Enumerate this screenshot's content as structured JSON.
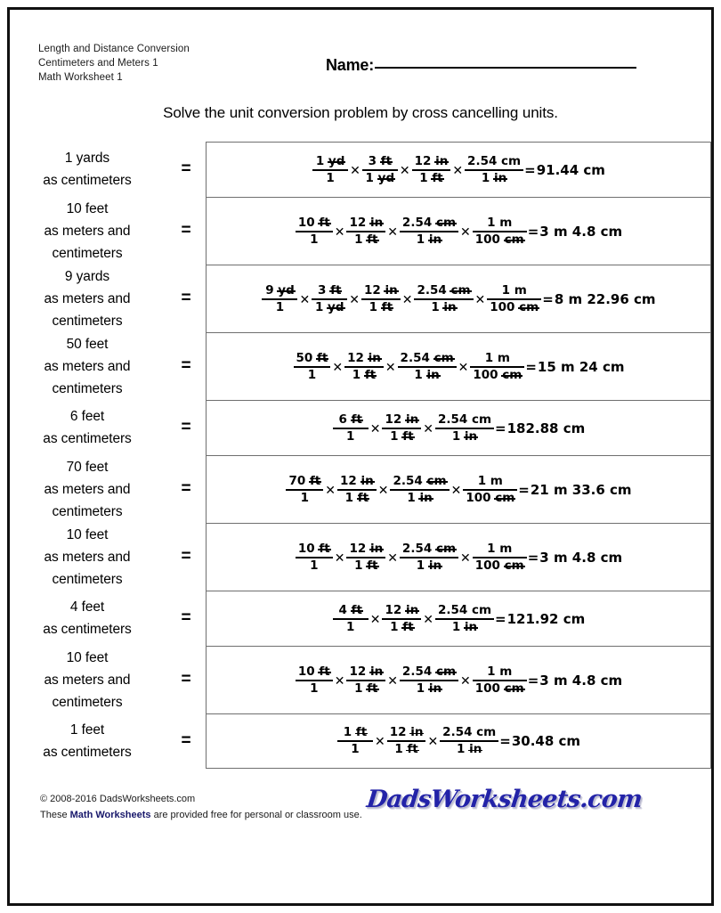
{
  "page": {
    "border_color": "#111111",
    "background": "#ffffff"
  },
  "header": {
    "meta_line1": "Length and Distance Conversion",
    "meta_line2": "Centimeters and Meters 1",
    "meta_line3": "Math Worksheet 1",
    "name_label": "Name:",
    "name_value": ""
  },
  "instructions": "Solve the unit conversion problem by cross cancelling units.",
  "equals": "=",
  "times": "✕",
  "problems": [
    {
      "prompt": [
        "1 yards",
        "as centimeters"
      ],
      "height": "short",
      "factors": [
        {
          "num": "1 yd",
          "num_cancel": "yd",
          "den": "1",
          "den_cancel": ""
        },
        {
          "num": "3 ft",
          "num_cancel": "ft",
          "den": "1 yd",
          "den_cancel": "yd"
        },
        {
          "num": "12 in",
          "num_cancel": "in",
          "den": "1 ft",
          "den_cancel": "ft"
        },
        {
          "num": "2.54 cm",
          "num_cancel": "",
          "den": "1 in",
          "den_cancel": "in"
        }
      ],
      "result": "91.44 cm"
    },
    {
      "prompt": [
        "10 feet",
        "as meters and",
        "centimeters"
      ],
      "height": "tall",
      "factors": [
        {
          "num": "10 ft",
          "num_cancel": "ft",
          "den": "1",
          "den_cancel": ""
        },
        {
          "num": "12 in",
          "num_cancel": "in",
          "den": "1 ft",
          "den_cancel": "ft"
        },
        {
          "num": "2.54 cm",
          "num_cancel": "cm",
          "den": "1 in",
          "den_cancel": "in"
        },
        {
          "num": "1 m",
          "num_cancel": "",
          "den": "100 cm",
          "den_cancel": "cm"
        }
      ],
      "result": "3 m 4.8 cm"
    },
    {
      "prompt": [
        "9 yards",
        "as meters and",
        "centimeters"
      ],
      "height": "tall",
      "factors": [
        {
          "num": "9 yd",
          "num_cancel": "yd",
          "den": "1",
          "den_cancel": ""
        },
        {
          "num": "3 ft",
          "num_cancel": "ft",
          "den": "1 yd",
          "den_cancel": "yd"
        },
        {
          "num": "12 in",
          "num_cancel": "in",
          "den": "1 ft",
          "den_cancel": "ft"
        },
        {
          "num": "2.54 cm",
          "num_cancel": "cm",
          "den": "1 in",
          "den_cancel": "in"
        },
        {
          "num": "1 m",
          "num_cancel": "",
          "den": "100 cm",
          "den_cancel": "cm"
        }
      ],
      "result": "8 m 22.96 cm"
    },
    {
      "prompt": [
        "50 feet",
        "as meters and",
        "centimeters"
      ],
      "height": "tall",
      "factors": [
        {
          "num": "50 ft",
          "num_cancel": "ft",
          "den": "1",
          "den_cancel": ""
        },
        {
          "num": "12 in",
          "num_cancel": "in",
          "den": "1 ft",
          "den_cancel": "ft"
        },
        {
          "num": "2.54 cm",
          "num_cancel": "cm",
          "den": "1 in",
          "den_cancel": "in"
        },
        {
          "num": "1 m",
          "num_cancel": "",
          "den": "100 cm",
          "den_cancel": "cm"
        }
      ],
      "result": "15 m 24 cm"
    },
    {
      "prompt": [
        "6 feet",
        "as centimeters"
      ],
      "height": "short",
      "factors": [
        {
          "num": "6 ft",
          "num_cancel": "ft",
          "den": "1",
          "den_cancel": ""
        },
        {
          "num": "12 in",
          "num_cancel": "in",
          "den": "1 ft",
          "den_cancel": "ft"
        },
        {
          "num": "2.54 cm",
          "num_cancel": "",
          "den": "1 in",
          "den_cancel": "in"
        }
      ],
      "result": "182.88 cm"
    },
    {
      "prompt": [
        "70 feet",
        "as meters and",
        "centimeters"
      ],
      "height": "tall",
      "factors": [
        {
          "num": "70 ft",
          "num_cancel": "ft",
          "den": "1",
          "den_cancel": ""
        },
        {
          "num": "12 in",
          "num_cancel": "in",
          "den": "1 ft",
          "den_cancel": "ft"
        },
        {
          "num": "2.54 cm",
          "num_cancel": "cm",
          "den": "1 in",
          "den_cancel": "in"
        },
        {
          "num": "1 m",
          "num_cancel": "",
          "den": "100 cm",
          "den_cancel": "cm"
        }
      ],
      "result": "21 m 33.6 cm"
    },
    {
      "prompt": [
        "10 feet",
        "as meters and",
        "centimeters"
      ],
      "height": "tall",
      "factors": [
        {
          "num": "10 ft",
          "num_cancel": "ft",
          "den": "1",
          "den_cancel": ""
        },
        {
          "num": "12 in",
          "num_cancel": "in",
          "den": "1 ft",
          "den_cancel": "ft"
        },
        {
          "num": "2.54 cm",
          "num_cancel": "cm",
          "den": "1 in",
          "den_cancel": "in"
        },
        {
          "num": "1 m",
          "num_cancel": "",
          "den": "100 cm",
          "den_cancel": "cm"
        }
      ],
      "result": "3 m 4.8 cm"
    },
    {
      "prompt": [
        "4 feet",
        "as centimeters"
      ],
      "height": "short",
      "factors": [
        {
          "num": "4 ft",
          "num_cancel": "ft",
          "den": "1",
          "den_cancel": ""
        },
        {
          "num": "12 in",
          "num_cancel": "in",
          "den": "1 ft",
          "den_cancel": "ft"
        },
        {
          "num": "2.54 cm",
          "num_cancel": "",
          "den": "1 in",
          "den_cancel": "in"
        }
      ],
      "result": "121.92 cm"
    },
    {
      "prompt": [
        "10 feet",
        "as meters and",
        "centimeters"
      ],
      "height": "tall",
      "factors": [
        {
          "num": "10 ft",
          "num_cancel": "ft",
          "den": "1",
          "den_cancel": ""
        },
        {
          "num": "12 in",
          "num_cancel": "in",
          "den": "1 ft",
          "den_cancel": "ft"
        },
        {
          "num": "2.54 cm",
          "num_cancel": "cm",
          "den": "1 in",
          "den_cancel": "in"
        },
        {
          "num": "1 m",
          "num_cancel": "",
          "den": "100 cm",
          "den_cancel": "cm"
        }
      ],
      "result": "3 m 4.8 cm"
    },
    {
      "prompt": [
        "1 feet",
        "as centimeters"
      ],
      "height": "short",
      "factors": [
        {
          "num": "1 ft",
          "num_cancel": "ft",
          "den": "1",
          "den_cancel": ""
        },
        {
          "num": "12 in",
          "num_cancel": "in",
          "den": "1 ft",
          "den_cancel": "ft"
        },
        {
          "num": "2.54 cm",
          "num_cancel": "",
          "den": "1 in",
          "den_cancel": "in"
        }
      ],
      "result": "30.48 cm"
    }
  ],
  "footer": {
    "copyright": "© 2008-2016 DadsWorksheets.com",
    "usage_prefix": "These",
    "usage_link": "Math Worksheets",
    "usage_suffix": "are provided free for personal or classroom use.",
    "logo_text": "DadsWorksheets.com",
    "link_color": "#18186b",
    "logo_color": "#2323a8"
  }
}
